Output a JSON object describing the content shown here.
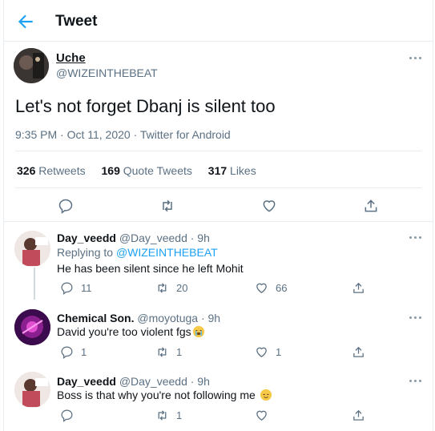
{
  "header": {
    "title": "Tweet",
    "back_icon": "arrow-left-icon",
    "accent": "#1da1f2"
  },
  "tweet": {
    "name": "Uche",
    "handle": "@WIZEINTHEBEAT",
    "text": "Let's not forget Dbanj is silent too",
    "meta": "9:35 PM · Oct 11, 2020 · Twitter for Android",
    "retweets_count": "326",
    "retweets_label": "Retweets",
    "quotes_count": "169",
    "quotes_label": "Quote Tweets",
    "likes_count": "317",
    "likes_label": "Likes",
    "actions": [
      "reply-icon",
      "retweet-icon",
      "like-icon",
      "share-icon"
    ]
  },
  "replies": [
    {
      "name": "Day_veedd",
      "meta": "@Day_veedd · 9h",
      "replying_prefix": "Replying to",
      "replying_handle": "@WIZEINTHEBEAT",
      "text": "He has been silent since he left Mohit",
      "reply_count": "11",
      "retweet_count": "20",
      "like_count": "66"
    },
    {
      "name": "Chemical Son.",
      "meta": "@moyotuga · 9h",
      "text": "David you're too violent fgs",
      "emoji": "loudly-crying-face-emoji",
      "reply_count": "1",
      "retweet_count": "1",
      "like_count": "1"
    },
    {
      "name": "Day_veedd",
      "meta": "@Day_veedd · 9h",
      "text": "Boss is that why you're not following me",
      "emoji": "relieved-face-emoji",
      "reply_count": "",
      "retweet_count": "1",
      "like_count": ""
    }
  ]
}
